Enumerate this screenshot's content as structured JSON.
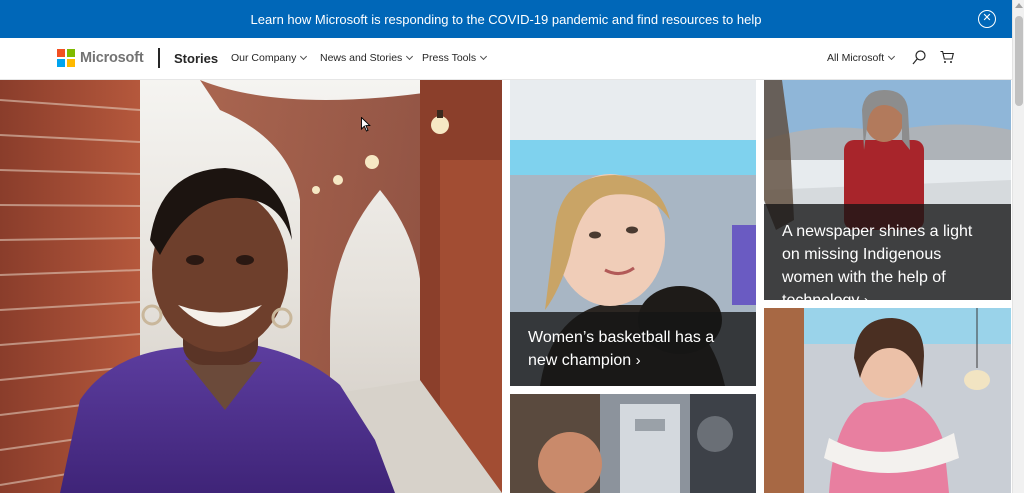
{
  "banner": {
    "text": "Learn how Microsoft is responding to the COVID-19 pandemic and find resources to help",
    "close_glyph": "✕"
  },
  "nav": {
    "logo_text": "Microsoft",
    "logo_colors": [
      "#f25022",
      "#7fba00",
      "#00a4ef",
      "#ffb900"
    ],
    "section_title": "Stories",
    "menus": [
      {
        "label": "Our Company"
      },
      {
        "label": "News and Stories"
      },
      {
        "label": "Press Tools"
      }
    ],
    "all_microsoft": "All Microsoft",
    "icons": [
      "search-icon",
      "cart-icon"
    ]
  },
  "tiles": {
    "hero": {
      "caption": ""
    },
    "basketball": {
      "caption": "Women’s basketball has a new champion",
      "arrow": "›"
    },
    "newspaper": {
      "caption": "A newspaper shines a light on missing Indigenous women with the help of technology",
      "arrow": "›"
    },
    "lab": {
      "caption": ""
    },
    "pink": {
      "caption": ""
    }
  },
  "colors": {
    "banner_bg": "#0067b8",
    "caption_bg": "#141414"
  }
}
